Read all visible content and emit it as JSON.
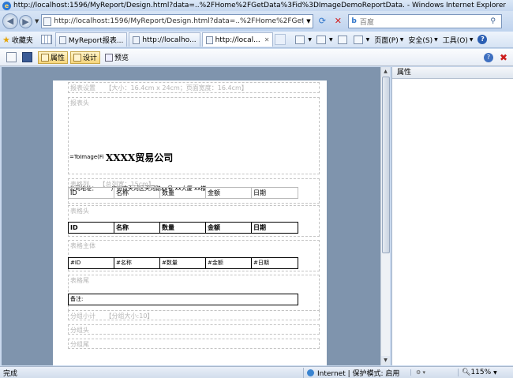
{
  "window": {
    "title": "http://localhost:1596/MyReport/Design.html?data=..%2FHome%2FGetData%3Fid%3DImageDemoReportData. - Windows Internet Explorer"
  },
  "address_bar": {
    "url": "http://localhost:1596/MyReport/Design.html?data=..%2FHome%2FGetData%3F",
    "search_placeholder": "百度",
    "search_provider_icon": "b"
  },
  "favorites": {
    "label": "收藏夹"
  },
  "tabs": [
    {
      "label": "MyReport报表...",
      "active": false
    },
    {
      "label": "http://localho...",
      "active": false
    },
    {
      "label": "http://local...",
      "active": true
    }
  ],
  "command_bar": {
    "page": "页面(P)",
    "safety": "安全(S)",
    "tools": "工具(O)"
  },
  "designer_toolbar": {
    "properties_label": "属性",
    "design_label": "设计",
    "preview_label": "预览"
  },
  "report": {
    "report_settings_label": "报表设置",
    "report_settings_info": "【大小：16.4cm x 24cm；页面宽度：16.4cm】",
    "report_header_label": "报表头",
    "image_expression": "=ToImage(Fi",
    "company_name": "XXXX贸易公司",
    "address_label": "公司地址：",
    "address_value": "广州市天河区天河路xx号 xx大厦 xx楼",
    "table_columns_label": "表格列",
    "table_columns_info": "【总列宽：15cm】",
    "column_names": [
      "ID",
      "名称",
      "数量",
      "金额",
      "日期"
    ],
    "table_header_label": "表格头",
    "header_cells": [
      "ID",
      "名称",
      "数量",
      "金额",
      "日期"
    ],
    "table_body_label": "表格主体",
    "body_cells": [
      "#ID",
      "#名称",
      "#数量",
      "#金额",
      "#日期"
    ],
    "table_footer_label": "表格尾",
    "remarks": "备注:",
    "group_label": "分组小计",
    "group_info": "【分组大小:10】",
    "group_header_label": "分组头",
    "group_footer_label": "分组尾"
  },
  "properties_panel": {
    "title": "属性"
  },
  "status_bar": {
    "status": "完成",
    "zone": "Internet | 保护模式: 启用",
    "zoom": "115%"
  },
  "colors": {
    "canvas_background": "#7f94ad",
    "chrome_blue": "#c5d7ef",
    "active_button": "#f6d67c"
  }
}
